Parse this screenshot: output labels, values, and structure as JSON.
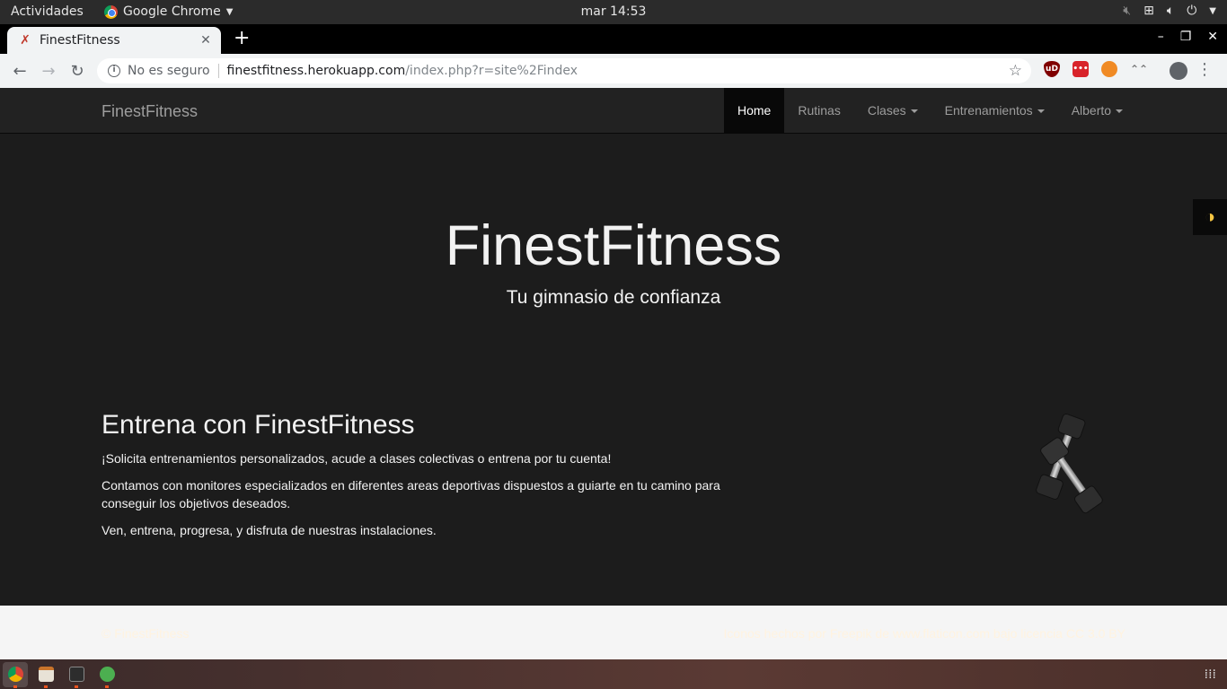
{
  "system_bar": {
    "activities": "Actividades",
    "app_name": "Google Chrome",
    "clock": "mar 14:53"
  },
  "browser": {
    "tab_title": "FinestFitness",
    "security_label": "No es seguro",
    "url_host": "finestfitness.herokuapp.com",
    "url_path": "/index.php?r=site%2Findex"
  },
  "navbar": {
    "brand": "FinestFitness",
    "items": [
      {
        "label": "Home",
        "active": true
      },
      {
        "label": "Rutinas"
      },
      {
        "label": "Clases",
        "dropdown": true
      },
      {
        "label": "Entrenamientos",
        "dropdown": true
      },
      {
        "label": "Alberto",
        "dropdown": true
      }
    ]
  },
  "hero": {
    "title": "FinestFitness",
    "subtitle": "Tu gimnasio de confianza"
  },
  "section": {
    "heading": "Entrena con FinestFitness",
    "paragraphs": [
      "¡Solicita entrenamientos personalizados, acude a clases colectivas o entrena por tu cuenta!",
      "Contamos con monitores especializados en diferentes areas deportivas dispuestos a guiarte en tu camino para conseguir los objetivos deseados.",
      "Ven, entrena, progresa, y disfruta de nuestras instalaciones."
    ]
  },
  "footer": {
    "left": "© FinestFitness",
    "right": "Iconos hechos por Freepik de www.flaticon.com bajo licencia CC 3.0 BY"
  },
  "colors": {
    "page_bg": "#1c1c1c",
    "navbar_bg": "#222222",
    "active_nav_bg": "#080808",
    "contrast_icon": "#f5c542"
  }
}
